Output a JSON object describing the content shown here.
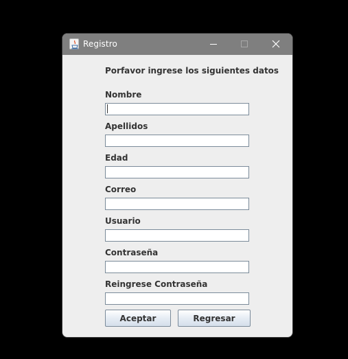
{
  "window": {
    "title": "Registro"
  },
  "form": {
    "instruction": "Porfavor ingrese los siguientes datos",
    "fields": [
      {
        "label": "Nombre",
        "value": ""
      },
      {
        "label": "Apellidos",
        "value": ""
      },
      {
        "label": "Edad",
        "value": ""
      },
      {
        "label": "Correo",
        "value": ""
      },
      {
        "label": "Usuario",
        "value": ""
      },
      {
        "label": "Contraseña",
        "value": ""
      },
      {
        "label": "Reingrese Contraseña",
        "value": ""
      }
    ]
  },
  "buttons": {
    "accept_label": "Aceptar",
    "back_label": "Regresar"
  },
  "colors": {
    "titlebar": "#7f7f7f",
    "window_bg": "#eeeeee",
    "field_border": "#7a8a99"
  }
}
